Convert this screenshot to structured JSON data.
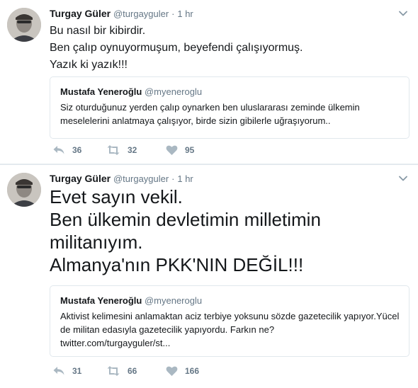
{
  "tweets": [
    {
      "name": "Turgay Güler",
      "handle": "@turgayguler",
      "separator": "·",
      "time": "1 hr",
      "text": "Bu nasıl bir kibirdir.\nBen çalıp oynuyormuşum, beyefendi çalışıyormuş.\nYazık ki yazık!!!",
      "quote": {
        "name": "Mustafa Yeneroğlu",
        "handle": "@myeneroglu",
        "text": "Siz oturduğunuz yerden çalıp oynarken ben uluslararası zeminde ülkemin meselelerini anlatmaya çalışıyor, birde sizin gibilerle uğraşıyorum.."
      },
      "actions": {
        "replies": "36",
        "retweets": "32",
        "likes": "95"
      }
    },
    {
      "name": "Turgay Güler",
      "handle": "@turgayguler",
      "separator": "·",
      "time": "1 hr",
      "text": "Evet sayın vekil.\nBen ülkemin devletimin milletimin militanıyım.\nAlmanya'nın PKK'NIN DEĞİL!!!",
      "quote": {
        "name": "Mustafa Yeneroğlu",
        "handle": "@myeneroglu",
        "text": "Aktivist kelimesini anlamaktan aciz terbiye yoksunu sözde gazetecilik yapıyor.Yücel de militan edasıyla gazetecilik yapıyordu. Farkın ne?\ntwitter.com/turgayguler/st..."
      },
      "actions": {
        "replies": "31",
        "retweets": "66",
        "likes": "166"
      }
    }
  ],
  "colors": {
    "text": "#14171a",
    "muted": "#657786",
    "border": "#e1e8ed"
  },
  "icons": [
    "avatar",
    "chevron-down-icon",
    "reply-icon",
    "retweet-icon",
    "heart-icon"
  ]
}
